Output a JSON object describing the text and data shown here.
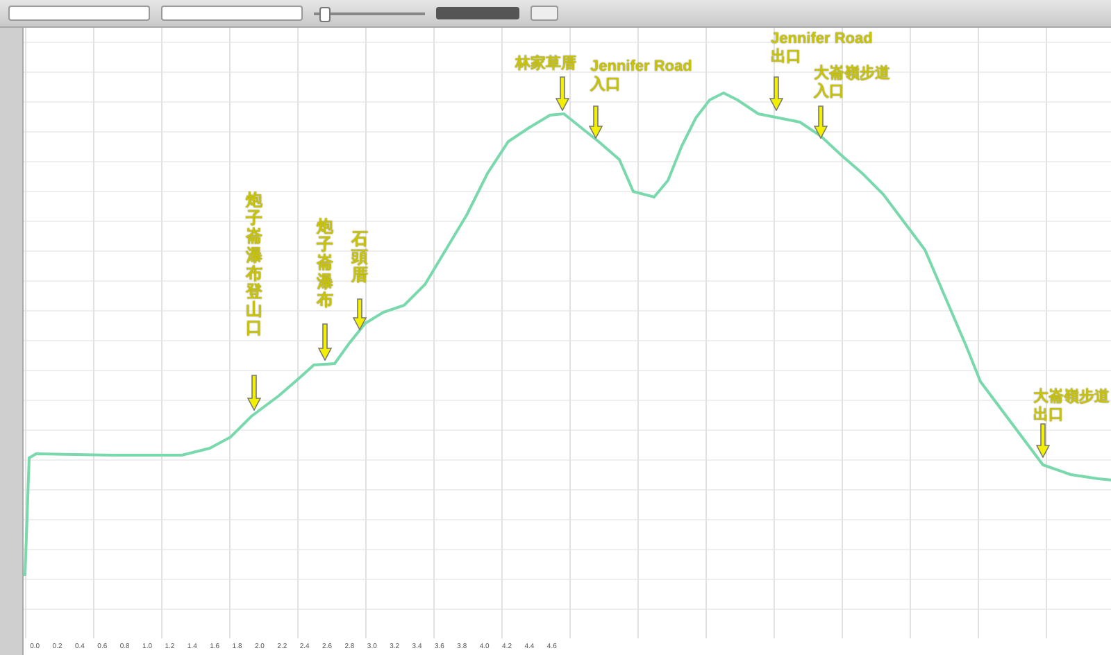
{
  "toolbar": {
    "controls": [
      {
        "kind": "dropdown"
      },
      {
        "kind": "dropdown"
      },
      {
        "kind": "slider",
        "level": 0.05
      },
      {
        "kind": "button"
      },
      {
        "kind": "stepper"
      }
    ]
  },
  "chart": {
    "annotations": [
      {
        "kind": "vertical",
        "lines": [
          "炮子崙瀑布登山口"
        ]
      },
      {
        "kind": "vertical",
        "lines": [
          "炮子崙瀑布"
        ]
      },
      {
        "kind": "vertical",
        "lines": [
          "石頭厝"
        ]
      },
      {
        "kind": "horizontal",
        "lines": [
          "林家草厝"
        ]
      },
      {
        "kind": "horizontal",
        "lines": [
          "Jennifer Road",
          "入口"
        ]
      },
      {
        "kind": "horizontal",
        "lines": [
          "Jennifer Road",
          "出口"
        ]
      },
      {
        "kind": "horizontal",
        "lines": [
          "大崙嶺步道",
          "入口"
        ]
      },
      {
        "kind": "horizontal",
        "lines": [
          "大崙嶺步道",
          "出口"
        ]
      }
    ],
    "x_tick_labels": [
      "0.0",
      "0.2",
      "0.4",
      "0.6",
      "0.8",
      "1.0",
      "1.2",
      "1.4",
      "1.6",
      "1.8",
      "2.0",
      "2.2",
      "2.4",
      "2.6",
      "2.8",
      "3.0",
      "3.2",
      "3.4",
      "3.6",
      "3.8",
      "4.0",
      "4.2",
      "4.4",
      "4.6"
    ]
  }
}
